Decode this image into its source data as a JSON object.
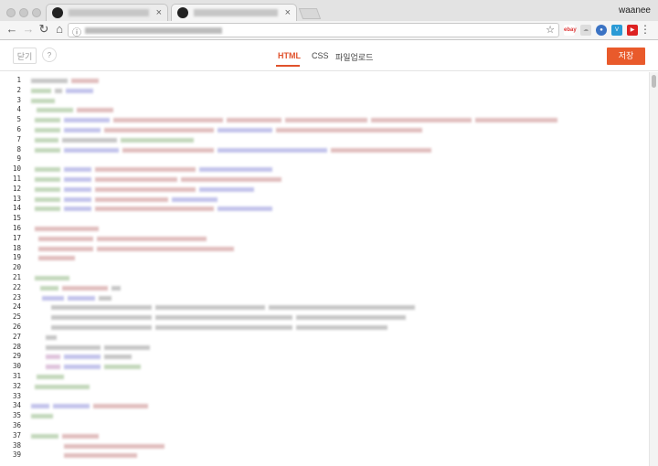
{
  "browser": {
    "profile": "waanee",
    "extensions": [
      "ebay",
      "cloud",
      "shield",
      "vpn",
      "youtube"
    ]
  },
  "editor": {
    "close_label": "닫기",
    "help_label": "?",
    "tabs": [
      "HTML",
      "CSS",
      "파일업로드"
    ],
    "active_tab": "HTML",
    "save_label": "저장"
  },
  "line_numbers": [
    "1",
    "2",
    "3",
    "4",
    "5",
    "6",
    "7",
    "8",
    "9",
    "10",
    "11",
    "12",
    "13",
    "14",
    "15",
    "16",
    "17",
    "18",
    "19",
    "20",
    "21",
    "22",
    "23",
    "24",
    "25",
    "26",
    "27",
    "28",
    "29",
    "30",
    "31",
    "32",
    "33",
    "34",
    "35",
    "36",
    "37",
    "38",
    "39"
  ],
  "colors": {
    "accent": "#e95a2b",
    "active_tab_text": "#e0522c"
  }
}
